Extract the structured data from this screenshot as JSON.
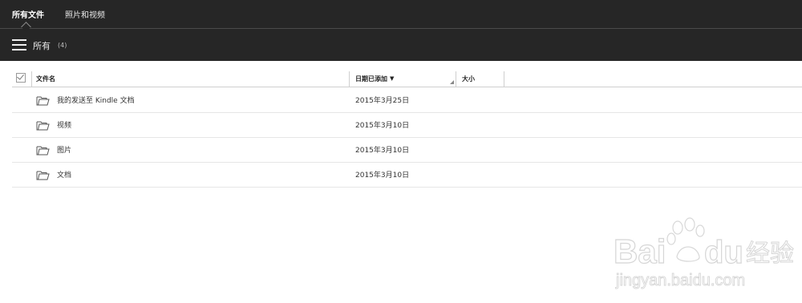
{
  "tabs": [
    {
      "label": "所有文件",
      "active": true
    },
    {
      "label": "照片和视频",
      "active": false
    }
  ],
  "toolbar": {
    "folder_title": "所有",
    "item_count": "(4)"
  },
  "columns": {
    "name": "文件名",
    "date_added": "日期已添加",
    "date_sort_icon": "chevron-down-icon",
    "size": "大小"
  },
  "files": [
    {
      "name": "我的发送至 Kindle 文档",
      "date": "2015年3月25日",
      "icon": "folder-icon"
    },
    {
      "name": "视频",
      "date": "2015年3月10日",
      "icon": "folder-icon"
    },
    {
      "name": "图片",
      "date": "2015年3月10日",
      "icon": "folder-icon"
    },
    {
      "name": "文档",
      "date": "2015年3月10日",
      "icon": "folder-icon"
    }
  ],
  "watermark": {
    "brand": "Baidu经验",
    "url": "jingyan.baidu.com"
  },
  "colors": {
    "header_bg": "#262626",
    "background": "#ffffff"
  }
}
